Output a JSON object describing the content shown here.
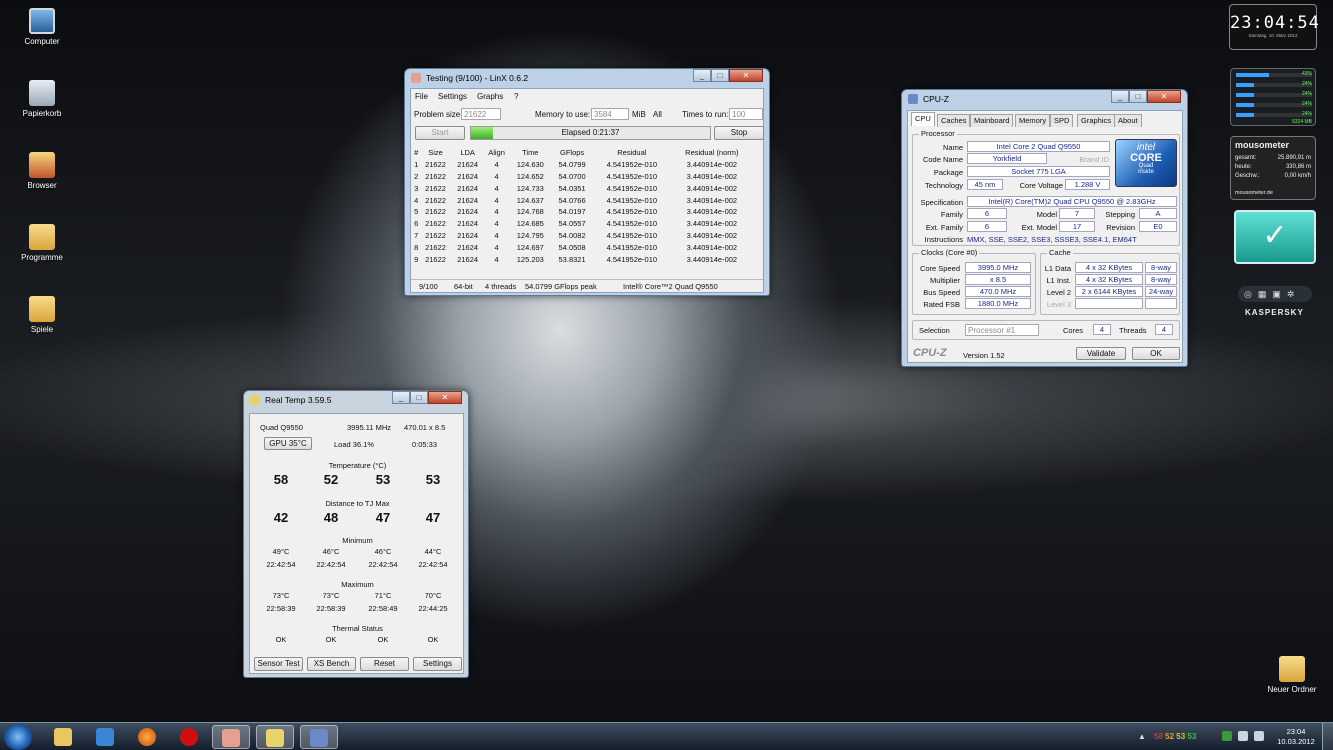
{
  "desktop": {
    "icons": [
      {
        "label": "Computer"
      },
      {
        "label": "Papierkorb"
      },
      {
        "label": "Browser"
      },
      {
        "label": "Programme"
      },
      {
        "label": "Spiele"
      },
      {
        "label": "Neuer Ordner"
      }
    ]
  },
  "linx": {
    "title": "Testing (9/100) - LinX 0.6.2",
    "menu": [
      "File",
      "Settings",
      "Graphs",
      "?"
    ],
    "problem_size_label": "Problem size:",
    "problem_size": "21622",
    "memory_label": "Memory to use:",
    "memory": "3584",
    "memory_unit": "MiB",
    "memory_all": "All",
    "times_label": "Times to run:",
    "times": "100",
    "start": "Start",
    "elapsed": "Elapsed 0:21:37",
    "stop": "Stop",
    "columns": [
      "#",
      "Size",
      "LDA",
      "Align",
      "Time",
      "GFlops",
      "Residual",
      "Residual (norm)"
    ],
    "rows": [
      [
        "1",
        "21622",
        "21624",
        "4",
        "124.630",
        "54.0799",
        "4.541952e-010",
        "3.440914e-002"
      ],
      [
        "2",
        "21622",
        "21624",
        "4",
        "124.652",
        "54.0700",
        "4.541952e-010",
        "3.440914e-002"
      ],
      [
        "3",
        "21622",
        "21624",
        "4",
        "124.733",
        "54.0351",
        "4.541952e-010",
        "3.440914e-002"
      ],
      [
        "4",
        "21622",
        "21624",
        "4",
        "124.637",
        "54.0766",
        "4.541952e-010",
        "3.440914e-002"
      ],
      [
        "5",
        "21622",
        "21624",
        "4",
        "124.768",
        "54.0197",
        "4.541952e-010",
        "3.440914e-002"
      ],
      [
        "6",
        "21622",
        "21624",
        "4",
        "124.685",
        "54.0557",
        "4.541952e-010",
        "3.440914e-002"
      ],
      [
        "7",
        "21622",
        "21624",
        "4",
        "124.795",
        "54.0082",
        "4.541952e-010",
        "3.440914e-002"
      ],
      [
        "8",
        "21622",
        "21624",
        "4",
        "124.697",
        "54.0508",
        "4.541952e-010",
        "3.440914e-002"
      ],
      [
        "9",
        "21622",
        "21624",
        "4",
        "125.203",
        "53.8321",
        "4.541952e-010",
        "3.440914e-002"
      ]
    ],
    "status": [
      "9/100",
      "64-bit",
      "4 threads",
      "54.0799 GFlops peak",
      "Intel® Core™2 Quad Q9550"
    ]
  },
  "cpuz": {
    "title": "CPU-Z",
    "tabs": [
      "CPU",
      "Caches",
      "Mainboard",
      "Memory",
      "SPD",
      "Graphics",
      "About"
    ],
    "processor_label": "Processor",
    "name_label": "Name",
    "name": "Intel Core 2 Quad Q9550",
    "codename_label": "Code Name",
    "codename": "Yorkfield",
    "brandid_label": "Brand ID",
    "package_label": "Package",
    "package": "Socket 775 LGA",
    "technology_label": "Technology",
    "technology": "45 nm",
    "corevoltage_label": "Core Voltage",
    "corevoltage": "1.288 V",
    "spec_label": "Specification",
    "spec": "Intel(R) Core(TM)2 Quad CPU    Q9550  @ 2.83GHz",
    "family_label": "Family",
    "family": "6",
    "model_label": "Model",
    "model": "7",
    "stepping_label": "Stepping",
    "stepping": "A",
    "extfamily_label": "Ext. Family",
    "extfamily": "6",
    "extmodel_label": "Ext. Model",
    "extmodel": "17",
    "revision_label": "Revision",
    "revision": "E0",
    "instructions_label": "Instructions",
    "instructions": "MMX, SSE, SSE2, SSE3, SSSE3, SSE4.1, EM64T",
    "clocks_label": "Clocks (Core #0)",
    "corespeed_label": "Core Speed",
    "corespeed": "3995.0 MHz",
    "multiplier_label": "Multiplier",
    "multiplier": "x 8.5",
    "busspeed_label": "Bus Speed",
    "busspeed": "470.0 MHz",
    "ratedfsb_label": "Rated FSB",
    "ratedfsb": "1880.0 MHz",
    "cache_label": "Cache",
    "l1d_label": "L1 Data",
    "l1d": "4 x 32 KBytes",
    "l1d_way": "8-way",
    "l1i_label": "L1 Inst.",
    "l1i": "4 x 32 KBytes",
    "l1i_way": "8-way",
    "l2_label": "Level 2",
    "l2": "2 x 6144 KBytes",
    "l2_way": "24-way",
    "l3_label": "Level 3",
    "selection_label": "Selection",
    "selection": "Processor #1",
    "cores_label": "Cores",
    "cores": "4",
    "threads_label": "Threads",
    "threads": "4",
    "brand": "CPU-Z",
    "version": "Version 1.52",
    "validate": "Validate",
    "ok": "OK",
    "logo_line1": "intel",
    "logo_line2": "CORE",
    "logo_line3": "Quad",
    "logo_line4": "inside"
  },
  "realtemp": {
    "title": "Real Temp 3.59.5",
    "cpu": "Quad Q9550",
    "mhz": "3995.11 MHz",
    "ratio": "470.01 x 8.5",
    "gpu": "GPU  35°C",
    "load": "Load  36.1%",
    "time": "0:05:33",
    "temp_label": "Temperature (°C)",
    "temps": [
      "58",
      "52",
      "53",
      "53"
    ],
    "dist_label": "Distance to TJ Max",
    "dists": [
      "42",
      "48",
      "47",
      "47"
    ],
    "min_label": "Minimum",
    "mins": [
      "49°C",
      "46°C",
      "46°C",
      "44°C"
    ],
    "min_times": [
      "22:42:54",
      "22:42:54",
      "22:42:54",
      "22:42:54"
    ],
    "max_label": "Maximum",
    "maxs": [
      "73°C",
      "73°C",
      "71°C",
      "70°C"
    ],
    "max_times": [
      "22:58:39",
      "22:58:39",
      "22:58:49",
      "22:44:25"
    ],
    "thermal_label": "Thermal Status",
    "thermal": [
      "OK",
      "OK",
      "OK",
      "OK"
    ],
    "buttons": [
      "Sensor Test",
      "XS Bench",
      "Reset",
      "Settings"
    ]
  },
  "gadgets": {
    "clock": "23:04:54",
    "clock_date": "Samstag, 10. März 2012",
    "meter_pcts": [
      "43%",
      "24%",
      "24%",
      "24%",
      "24%"
    ],
    "meter_mem": "5324 MB",
    "mousometer_title": "mousometer",
    "mouse_rows": [
      [
        "gesamt:",
        "25.890,91 m"
      ],
      [
        "heute:",
        "330,86 m"
      ],
      [
        "Geschw.:",
        "0,00 km/h"
      ]
    ],
    "mouse_footer": "mousometer.de",
    "kaspersky": "KASPERSKY"
  },
  "taskbar": {
    "tray_temps": [
      "58",
      "52",
      "53",
      "53"
    ],
    "time": "23:04",
    "date": "10.03.2012"
  },
  "colors": {
    "accent_blue": "#1a2a8a",
    "green_progress": "#5cc83a",
    "tray_red": "#e03030",
    "tray_yellow": "#e0c030",
    "tray_green": "#30c030"
  }
}
